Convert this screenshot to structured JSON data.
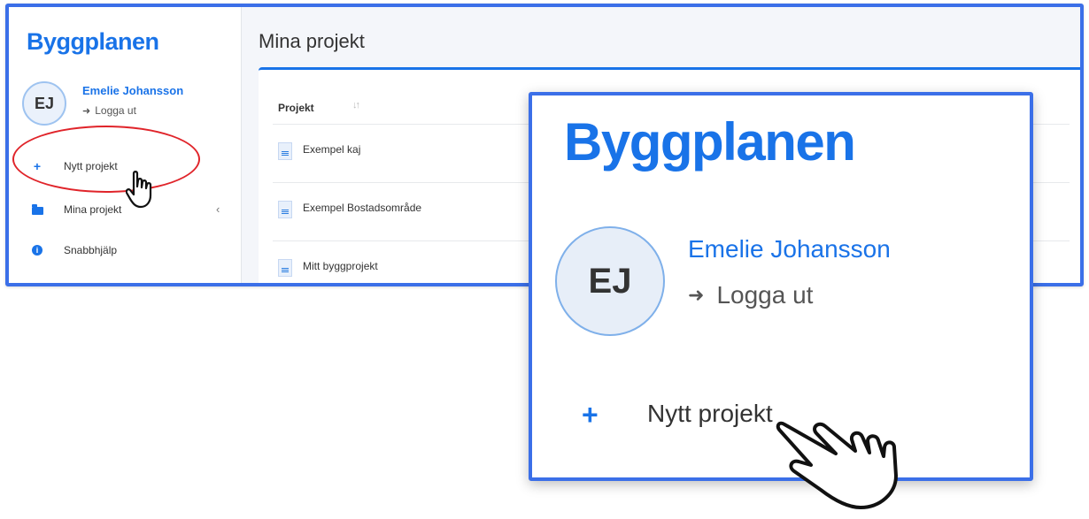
{
  "app": {
    "brand": "Byggplanen",
    "user": {
      "initials": "EJ",
      "name": "Emelie Johansson",
      "logout_label": "Logga ut"
    },
    "nav": {
      "new_project": "Nytt projekt",
      "my_projects": "Mina projekt",
      "quick_help": "Snabbhjälp"
    },
    "page_title": "Mina projekt",
    "table": {
      "column_header": "Projekt",
      "rows": [
        {
          "label": "Exempel kaj"
        },
        {
          "label": "Exempel Bostadsområde"
        },
        {
          "label": "Mitt byggprojekt"
        }
      ]
    }
  },
  "zoom": {
    "brand": "Byggplanen",
    "initials": "EJ",
    "name": "Emelie Johansson",
    "logout_label": "Logga ut",
    "new_project": "Nytt projekt"
  },
  "colors": {
    "accent": "#1973e8",
    "frame": "#3b6fe8",
    "highlight": "#e0242a"
  }
}
